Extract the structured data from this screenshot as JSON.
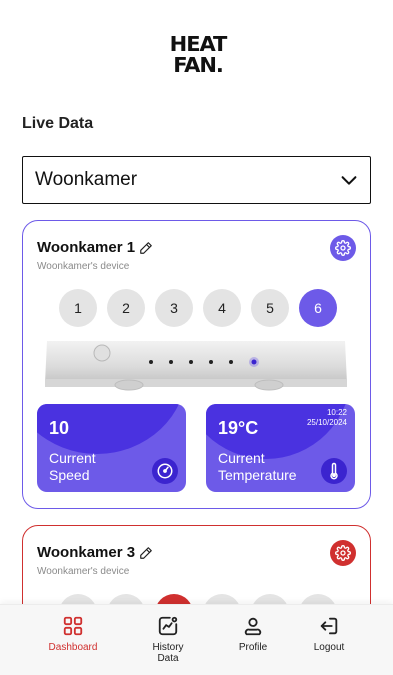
{
  "brand": {
    "logo_line1": "HEAT",
    "logo_line2": "FAN."
  },
  "section_title": "Live Data",
  "room_select": {
    "value": "Woonkamer"
  },
  "devices": [
    {
      "name": "Woonkamer 1",
      "subtitle": "Woonkamer's device",
      "accent": "#6d5ae8",
      "speeds": [
        "1",
        "2",
        "3",
        "4",
        "5",
        "6"
      ],
      "active_speed": "6",
      "speed_tile": {
        "value": "10",
        "label_line1": "Current",
        "label_line2": "Speed"
      },
      "temp_tile": {
        "value": "19°C",
        "label_line1": "Current",
        "label_line2": "Temperature",
        "time": "10:22",
        "date": "25/10/2024"
      }
    },
    {
      "name": "Woonkamer 3",
      "subtitle": "Woonkamer's device",
      "accent": "#d0302f"
    }
  ],
  "nav": {
    "dashboard": "Dashboard",
    "history_line1": "History",
    "history_line2": "Data",
    "profile": "Profile",
    "logout": "Logout",
    "active_color": "#d0302f"
  },
  "icons": [
    "edit-icon",
    "gear-icon",
    "chevron-down-icon",
    "gauge-icon",
    "thermometer-icon",
    "dashboard-grid-icon",
    "chart-icon",
    "user-icon",
    "logout-icon"
  ]
}
